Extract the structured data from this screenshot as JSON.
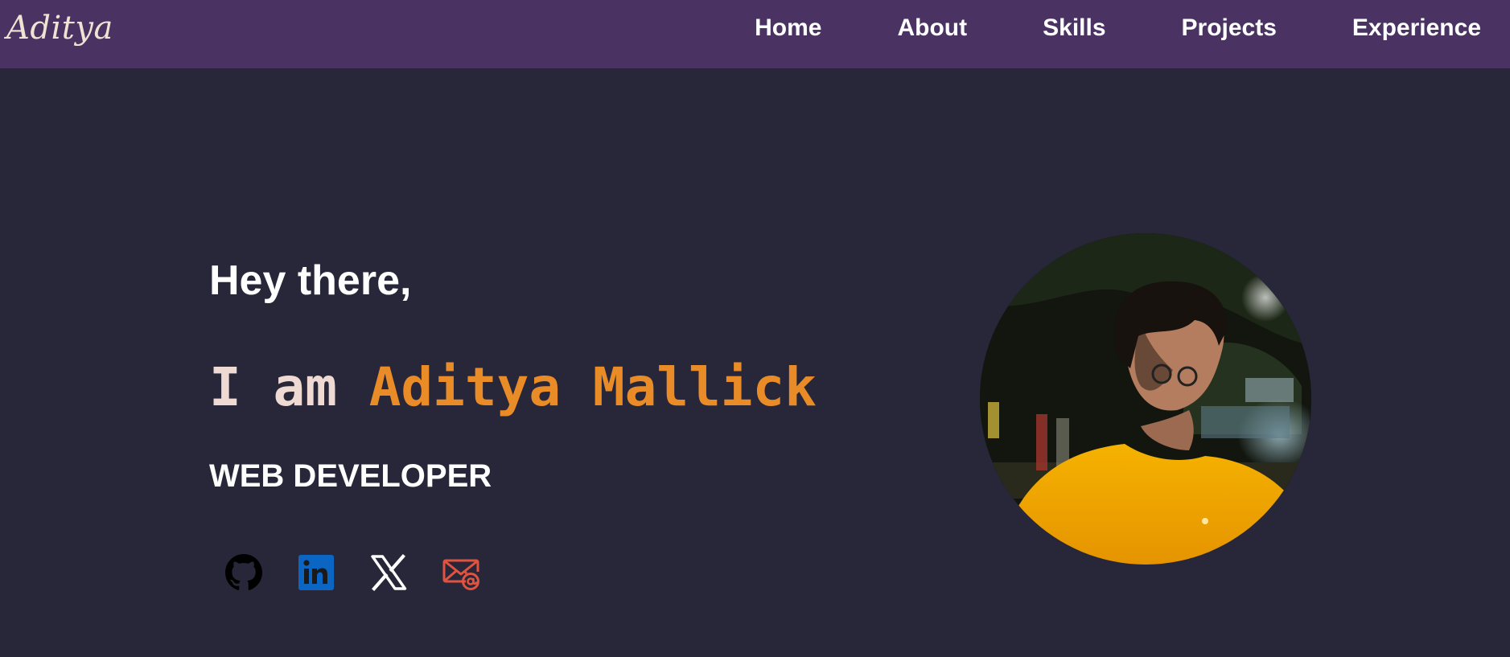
{
  "nav": {
    "brand": "Aditya",
    "links": [
      "Home",
      "About",
      "Skills",
      "Projects",
      "Experience"
    ]
  },
  "hero": {
    "greeting": "Hey there,",
    "intro_prefix": "I am ",
    "name": "Aditya Mallick",
    "role": "WEB DEVELOPER"
  },
  "socials": [
    {
      "icon": "github-icon",
      "color": "#000000"
    },
    {
      "icon": "linkedin-icon",
      "color": "#0a66c2"
    },
    {
      "icon": "x-icon",
      "color": "#ffffff"
    },
    {
      "icon": "email-icon",
      "color": "#e0533f"
    }
  ],
  "colors": {
    "background": "#282739",
    "navbar": "#4a3363",
    "accent": "#e98c27",
    "brand": "#f1e3d4"
  }
}
